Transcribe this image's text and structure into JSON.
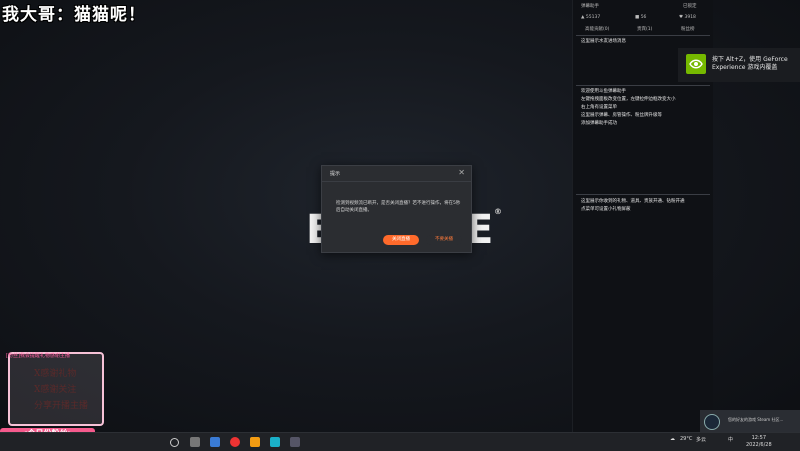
{
  "overlay": {
    "caption": "我大哥：猫猫呢！"
  },
  "logo": {
    "left": "E",
    "right": "E",
    "reg": "®"
  },
  "dialog": {
    "title": "提示",
    "close": "✕",
    "message": "检测到视频流已断开，是否关闭直播？若不进行操作，将在5秒后自动关闭直播。",
    "confirm": "关闭直播",
    "cancel": "不要关播"
  },
  "panel": {
    "header_left": "弹幕助手",
    "header_right": "已锁定",
    "stats": {
      "viewers": "55137",
      "fans": "56",
      "likes": "3918"
    },
    "tabs": [
      "高能贡献(0)",
      "贵宾(1)",
      "粉丝榜"
    ],
    "section1": "这里展示水友进场消息",
    "section2": [
      "欢迎使用斗鱼弹幕助手",
      "左键拖拽面板改变位置，左键拉伸边框改变大小",
      "右上角有设置菜单",
      "这里展示弹幕、房管操作、粉丝牌升级等",
      "添加弹幕助手成功"
    ],
    "section3": [
      "这里展示你收到的礼物、道具、贵族开通、钻粉开通",
      "点菜单可设置小礼物屏蔽"
    ]
  },
  "geforce": {
    "text": "按下 Alt+Z，使用 GeForce Experience 游戏内覆盖"
  },
  "steam": {
    "text": "您的好友的游戏 Steam 社区..."
  },
  "badge": {
    "top": "[粉丝]我会提醒礼物感谢主播",
    "lines": [
      "X感谢礼物",
      "X感谢关注",
      "分享开播主播"
    ],
    "bar": "<今日份粉丝>"
  },
  "taskbar": {
    "temp": "29°C",
    "weather": "多云",
    "ime": "中",
    "time": "12:57",
    "date": "2022/6/28"
  },
  "colors": {
    "accent": "#ff6a2b",
    "nvidia": "#76b900",
    "pink": "#f55b8d"
  }
}
